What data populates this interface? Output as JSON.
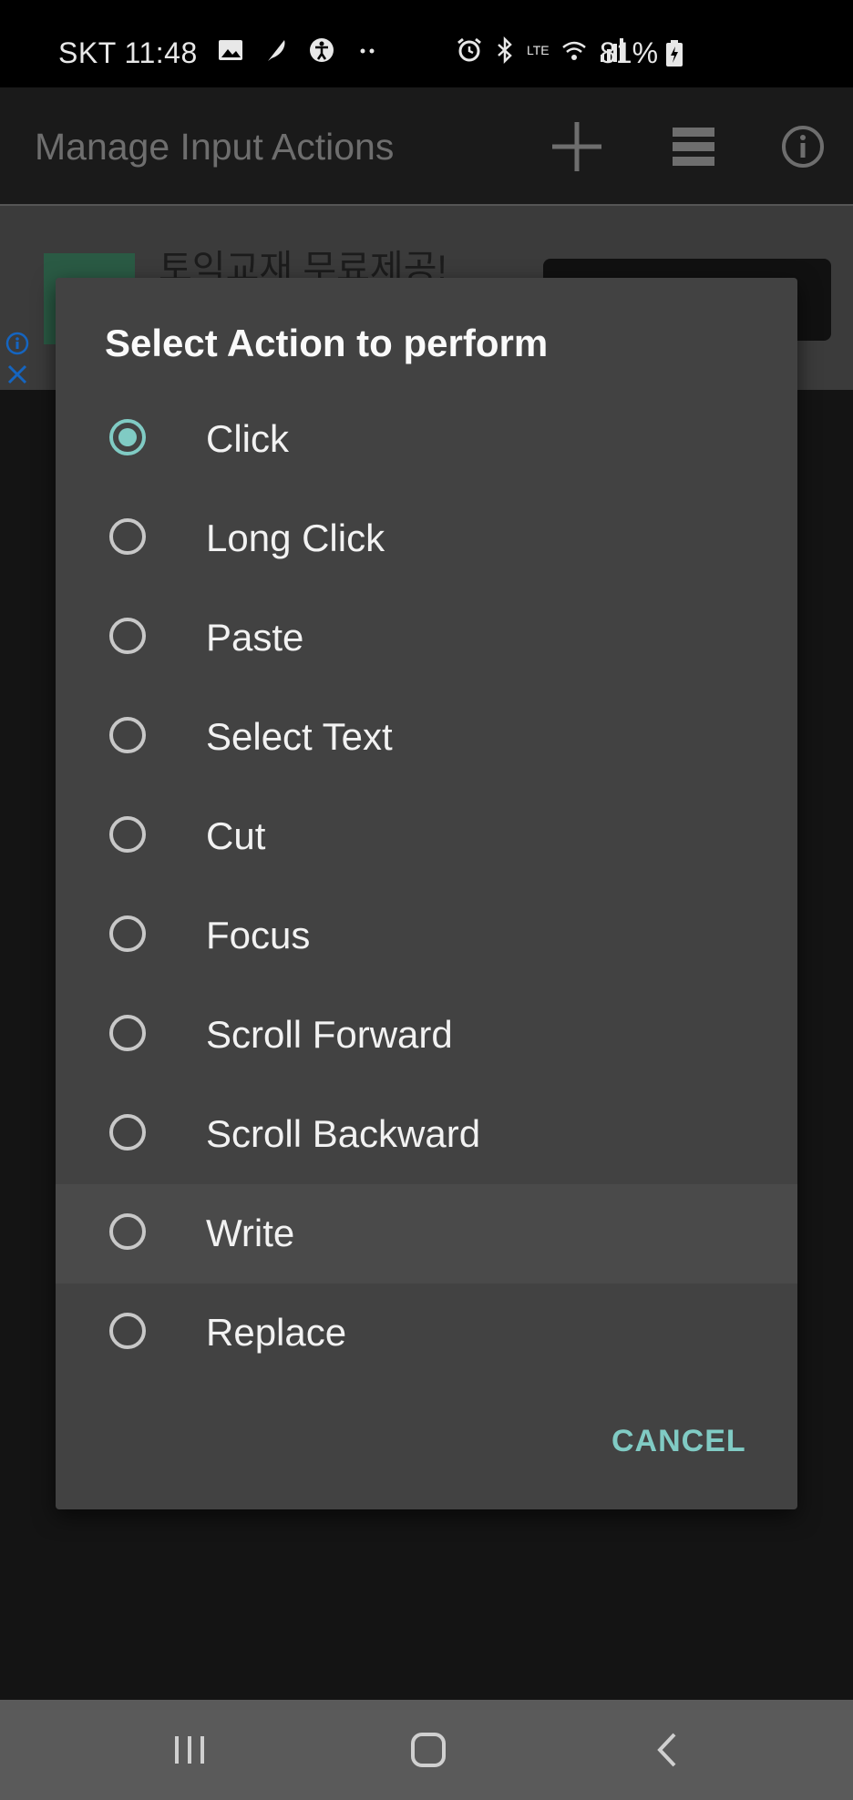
{
  "status_bar": {
    "carrier_time": "SKT 11:48",
    "signal_label": "LTE",
    "battery": "81%",
    "left_icons": [
      "gallery-icon",
      "feather-icon",
      "accessibility-icon",
      "more-dots-icon"
    ],
    "right_icons": [
      "alarm-icon",
      "bluetooth-icon",
      "wifi-icon",
      "signal-icon",
      "battery-charging-icon"
    ]
  },
  "app_bar": {
    "title": "Manage Input Actions",
    "actions": [
      "add-icon",
      "list-icon",
      "info-icon"
    ]
  },
  "ad": {
    "headline": "토익교재 무료제공!"
  },
  "dialog": {
    "title": "Select Action to perform",
    "options": [
      {
        "label": "Click",
        "checked": true
      },
      {
        "label": "Long Click",
        "checked": false
      },
      {
        "label": "Paste",
        "checked": false
      },
      {
        "label": "Select Text",
        "checked": false
      },
      {
        "label": "Cut",
        "checked": false
      },
      {
        "label": "Focus",
        "checked": false
      },
      {
        "label": "Scroll Forward",
        "checked": false
      },
      {
        "label": "Scroll Backward",
        "checked": false
      },
      {
        "label": "Write",
        "checked": false
      },
      {
        "label": "Replace",
        "checked": false
      }
    ],
    "cancel_label": "CANCEL"
  },
  "colors": {
    "accent": "#80cbc4",
    "dialog_bg": "#424242",
    "nav_bar": "#5a5a5a"
  },
  "nav_bar": {
    "buttons": [
      "recent-apps-icon",
      "home-icon",
      "back-icon"
    ]
  }
}
